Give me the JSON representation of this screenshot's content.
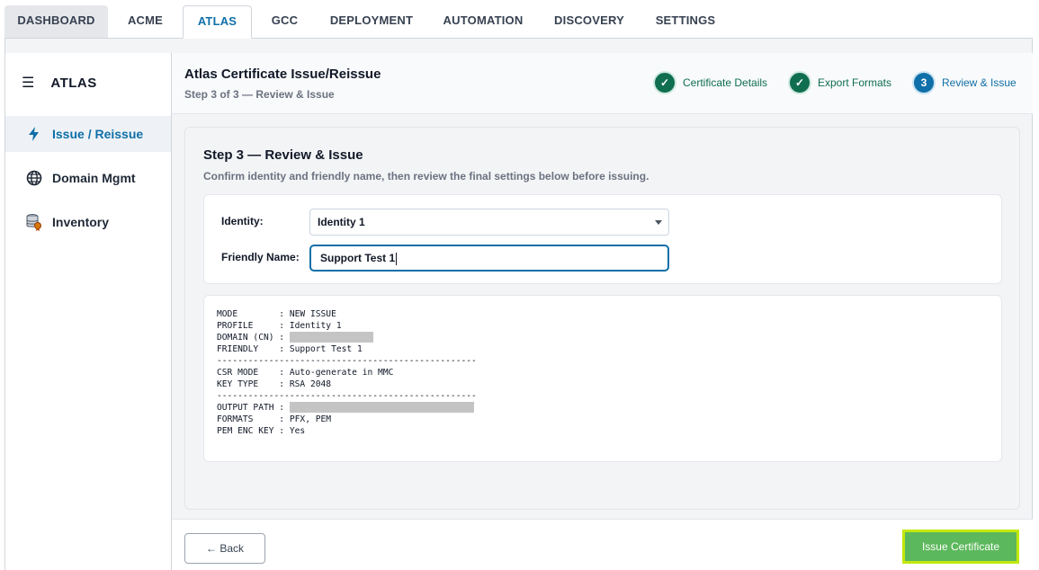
{
  "tabs": [
    {
      "label": "DASHBOARD",
      "active": false
    },
    {
      "label": "ACME",
      "active": false
    },
    {
      "label": "ATLAS",
      "active": true
    },
    {
      "label": "GCC",
      "active": false
    },
    {
      "label": "DEPLOYMENT",
      "active": false
    },
    {
      "label": "AUTOMATION",
      "active": false
    },
    {
      "label": "DISCOVERY",
      "active": false
    },
    {
      "label": "SETTINGS",
      "active": false
    }
  ],
  "sidebar": {
    "title": "ATLAS",
    "menu_icon": "hamburger-icon",
    "items": [
      {
        "label": "Issue / Reissue",
        "icon": "lightning-icon",
        "active": true
      },
      {
        "label": "Domain Mgmt",
        "icon": "globe-icon",
        "active": false
      },
      {
        "label": "Inventory",
        "icon": "database-certificate-icon",
        "active": false
      }
    ]
  },
  "header": {
    "title": "Atlas Certificate Issue/Reissue",
    "subtitle": "Step 3 of 3 — Review & Issue",
    "steps": [
      {
        "label": "Certificate Details",
        "state": "done",
        "marker": "✓"
      },
      {
        "label": "Export Formats",
        "state": "done",
        "marker": "✓"
      },
      {
        "label": "Review & Issue",
        "state": "current",
        "marker": "3"
      }
    ]
  },
  "card": {
    "title": "Step 3 — Review & Issue",
    "description": "Confirm identity and friendly name, then review the final settings below before issuing.",
    "identity_label": "Identity:",
    "identity_value": "Identity 1",
    "friendly_label": "Friendly Name:",
    "friendly_value": "Support Test 1"
  },
  "summary": {
    "mode_line": "MODE        : NEW ISSUE",
    "profile_line": "PROFILE     : Identity 1",
    "domain_line": "DOMAIN (CN) : ",
    "friendly_line": "FRIENDLY    : Support Test 1",
    "separator": "--------------------------------------------------",
    "csr_line": "CSR MODE    : Auto-generate in MMC",
    "key_line": "KEY TYPE    : RSA 2048",
    "output_line": "OUTPUT PATH : ",
    "formats_line": "FORMATS     : PFX, PEM",
    "pem_line": "PEM ENC KEY : Yes"
  },
  "footer": {
    "back_label": "← Back",
    "issue_label": "Issue Certificate"
  },
  "colors": {
    "accent": "#0f6fa8",
    "done": "#0f6e4f",
    "issue_button": "#5cb85c",
    "issue_highlight": "#c2e80c"
  }
}
